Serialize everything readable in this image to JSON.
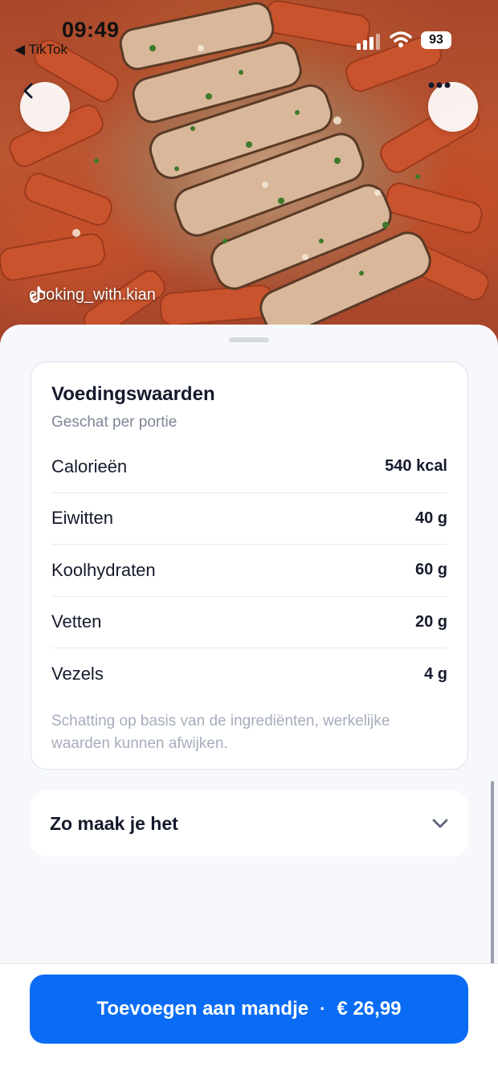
{
  "status_bar": {
    "time": "09:49",
    "back_app": "◀ TikTok",
    "battery": "93"
  },
  "hero": {
    "author": "cooking_with.kian",
    "icons": {
      "back": "chevron-left-icon",
      "more": "more-dots-icon",
      "brand": "tiktok-icon"
    }
  },
  "nutrition": {
    "title": "Voedingswaarden",
    "subtitle": "Geschat per portie",
    "rows": [
      {
        "label": "Calorieën",
        "value": "540 kcal"
      },
      {
        "label": "Eiwitten",
        "value": "40 g"
      },
      {
        "label": "Koolhydraten",
        "value": "60 g"
      },
      {
        "label": "Vetten",
        "value": "20 g"
      },
      {
        "label": "Vezels",
        "value": "4 g"
      }
    ],
    "note": "Schatting op basis van de ingrediënten, werkelijke waarden kunnen afwijken."
  },
  "howto": {
    "title": "Zo maak je het"
  },
  "cta": {
    "label": "Toevoegen aan mandje",
    "separator": "·",
    "price": "€ 26,99"
  },
  "colors": {
    "accent": "#0a6cf5",
    "text_primary": "#151a2c",
    "text_secondary": "#7d8697",
    "background": "#f7f8fc"
  }
}
